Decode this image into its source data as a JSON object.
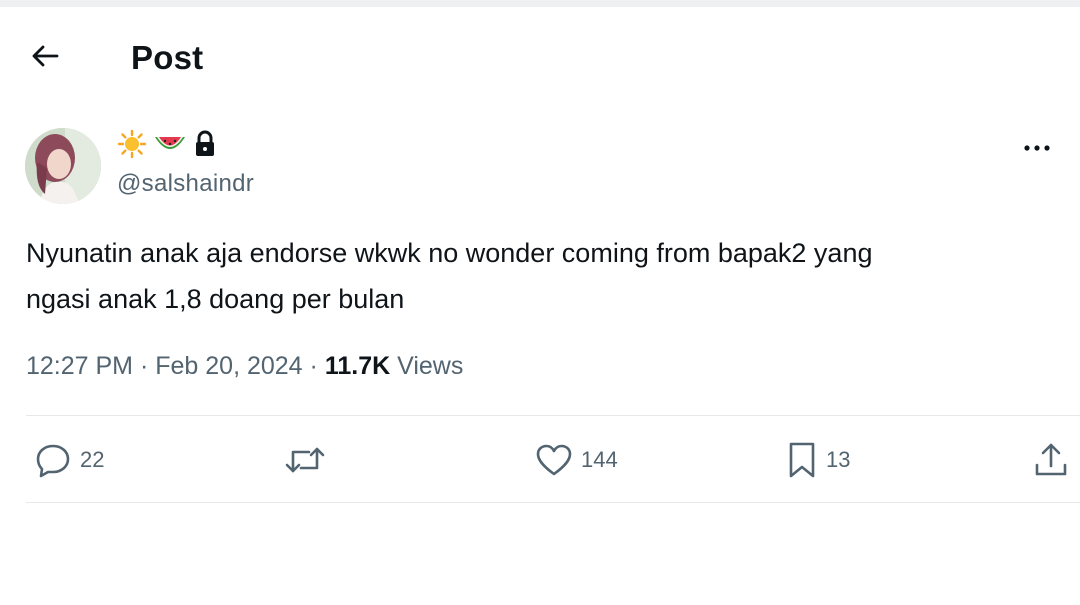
{
  "header": {
    "title": "Post",
    "back_icon": "arrow-left-icon"
  },
  "author": {
    "display_emoji": [
      "sun-emoji",
      "watermelon-emoji"
    ],
    "protected_icon": "lock-icon",
    "handle": "@salshaindr",
    "more_icon": "more-dots-icon"
  },
  "tweet": {
    "text_line1": "Nyunatin anak aja endorse wkwk no wonder coming from bapak2 yang",
    "text_line2": "ngasi anak 1,8 doang per bulan",
    "time": "12:27 PM",
    "separator": "·",
    "date": "Feb 20, 2024",
    "views_count": "11.7K",
    "views_label": "Views"
  },
  "actions": {
    "replies": "22",
    "reposts": "",
    "likes": "144",
    "bookmarks": "13"
  },
  "colors": {
    "text": "#0f1419",
    "secondary": "#536471",
    "divider": "#e6e9ea"
  }
}
